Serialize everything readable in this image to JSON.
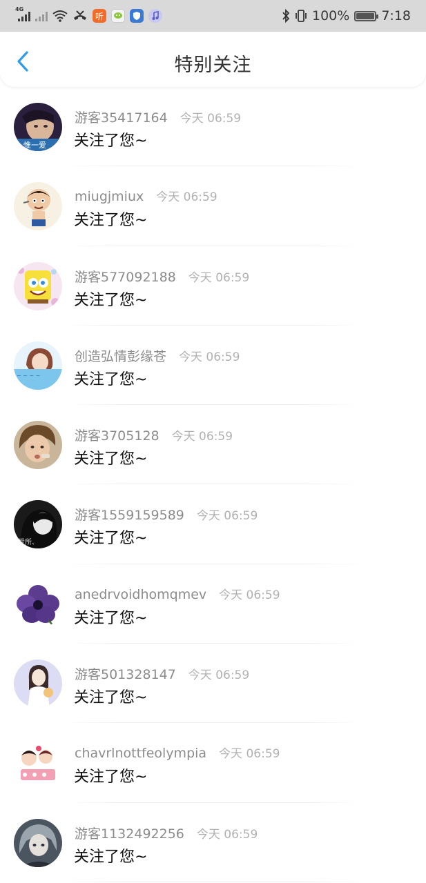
{
  "status_bar": {
    "network_label": "4G",
    "app_icon_1": "听",
    "battery_percent": "100%",
    "time": "7:18",
    "icons": [
      "signal-icon",
      "signal-no-sim-icon",
      "wifi-icon",
      "missed-call-icon",
      "ximalaya-app-icon",
      "chat-app-icon",
      "shield-app-icon",
      "music-app-icon",
      "bluetooth-icon",
      "vibrate-icon",
      "battery-icon"
    ]
  },
  "header": {
    "title": "特别关注",
    "back_icon": "chevron-left-icon",
    "accent_color": "#2f9bea"
  },
  "list": [
    {
      "name": "游客35417164",
      "time": "今天 06:59",
      "message": "关注了您~",
      "avatar_caption": "惟一爱"
    },
    {
      "name": "miugjmiux",
      "time": "今天 06:59",
      "message": "关注了您~"
    },
    {
      "name": "游客577092188",
      "time": "今天 06:59",
      "message": "关注了您~"
    },
    {
      "name": "创造弘情彭缘苍",
      "time": "今天 06:59",
      "message": "关注了您~"
    },
    {
      "name": "游客3705128",
      "time": "今天 06:59",
      "message": "关注了您~"
    },
    {
      "name": "游客1559159589",
      "time": "今天 06:59",
      "message": "关注了您~",
      "avatar_caption": "爱所、"
    },
    {
      "name": "anedrvoidhomqmev",
      "time": "今天 06:59",
      "message": "关注了您~"
    },
    {
      "name": "游客501328147",
      "time": "今天 06:59",
      "message": "关注了您~"
    },
    {
      "name": "chavrlnottfeolympia",
      "time": "今天 06:59",
      "message": "关注了您~"
    },
    {
      "name": "游客1132492256",
      "time": "今天 06:59",
      "message": "关注了您~"
    }
  ]
}
